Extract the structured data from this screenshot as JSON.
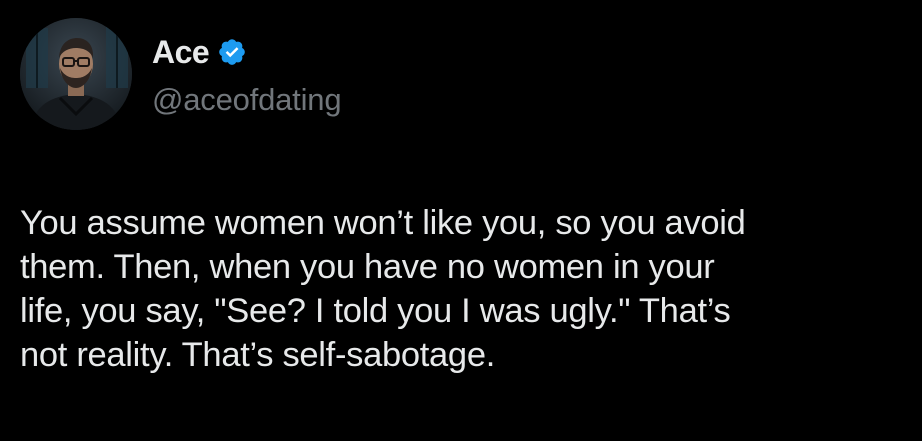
{
  "author": {
    "display_name": "Ace",
    "handle": "@aceofdating",
    "verified": true,
    "verified_icon": "verified-badge-icon",
    "avatar": "profile-photo"
  },
  "tweet": {
    "lines": [
      "You assume women won’t like you, so you avoid",
      "them. Then, when you have no women in your",
      "life, you say, \"See? I told you I was ugly.\" That’s",
      "not reality. That’s self-sabotage."
    ]
  },
  "colors": {
    "background": "#000000",
    "text": "#e7e9ea",
    "secondary_text": "#71767b",
    "verified_blue": "#1d9bf0"
  }
}
